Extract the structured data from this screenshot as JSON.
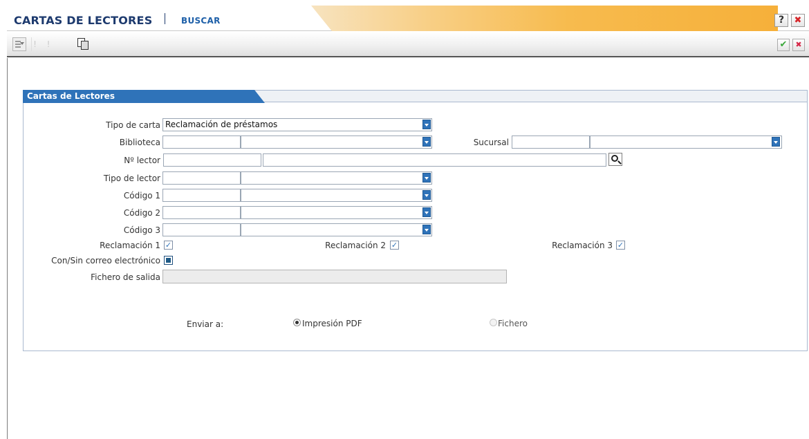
{
  "app": {
    "title": "CARTAS DE LECTORES",
    "mode": "BUSCAR",
    "help_label": "?",
    "close_label": "✖"
  },
  "toolbar": {
    "icons": [
      "menu-icon",
      "disabled-icon",
      "disabled-icon",
      "copy-icon",
      "accept-icon",
      "cancel-icon"
    ],
    "accept_glyph": "✔",
    "cancel_glyph": "✖"
  },
  "panel": {
    "title": "Cartas de Lectores"
  },
  "form": {
    "tipo_carta": {
      "label": "Tipo de carta",
      "value": "Reclamación de préstamos"
    },
    "biblioteca": {
      "label": "Biblioteca",
      "code": "",
      "name": ""
    },
    "sucursal": {
      "label": "Sucursal",
      "code": "",
      "name": ""
    },
    "n_lector": {
      "label": "Nº lector",
      "code": "",
      "name": ""
    },
    "tipo_lector": {
      "label": "Tipo de lector",
      "code": "",
      "name": ""
    },
    "codigo1": {
      "label": "Código 1",
      "code": "",
      "name": ""
    },
    "codigo2": {
      "label": "Código 2",
      "code": "",
      "name": ""
    },
    "codigo3": {
      "label": "Código 3",
      "code": "",
      "name": ""
    },
    "reclamacion1": {
      "label": "Reclamación 1",
      "checked": true
    },
    "reclamacion2": {
      "label": "Reclamación 2",
      "checked": true
    },
    "reclamacion3": {
      "label": "Reclamación 3",
      "checked": true
    },
    "correo": {
      "label": "Con/Sin correo electrónico",
      "state": "indeterminate"
    },
    "fichero_salida": {
      "label": "Fichero de salida",
      "value": ""
    },
    "enviar": {
      "label": "Enviar a:",
      "options": [
        {
          "label": "Impresión PDF",
          "selected": true
        },
        {
          "label": "Fichero",
          "selected": false
        }
      ]
    }
  },
  "colors": {
    "brand_navy": "#1d3a6e",
    "accent_blue": "#2f73b9",
    "title_orange": "#f6b03a"
  }
}
